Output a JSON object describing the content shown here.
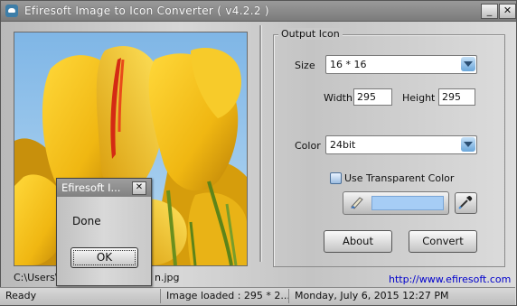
{
  "window": {
    "title": "Efiresoft Image to Icon Converter ( v4.2.2 )",
    "minimize_glyph": "_",
    "close_glyph": "✕"
  },
  "preview": {
    "file_caption": "C:\\Users\\",
    "file_caption_tail": "n.jpg"
  },
  "output_icon": {
    "group_title": "Output Icon",
    "size_label": "Size",
    "size_value": "16 * 16",
    "width_label": "Width",
    "width_value": "295",
    "height_label": "Height",
    "height_value": "295",
    "color_label": "Color",
    "color_value": "24bit",
    "transparent_label": "Use Transparent Color",
    "transparent_checked": false,
    "transparent_color": "#a6cdf5"
  },
  "buttons": {
    "about": "About",
    "convert": "Convert"
  },
  "link": "http://www.efiresoft.com",
  "status": {
    "state": "Ready",
    "image_info": "Image loaded : 295 * 2...",
    "datetime": "Monday, July 6,  2015 12:27 PM"
  },
  "dialog": {
    "title": "Efiresoft I...",
    "message": "Done",
    "ok": "OK",
    "close_glyph": "✕"
  }
}
